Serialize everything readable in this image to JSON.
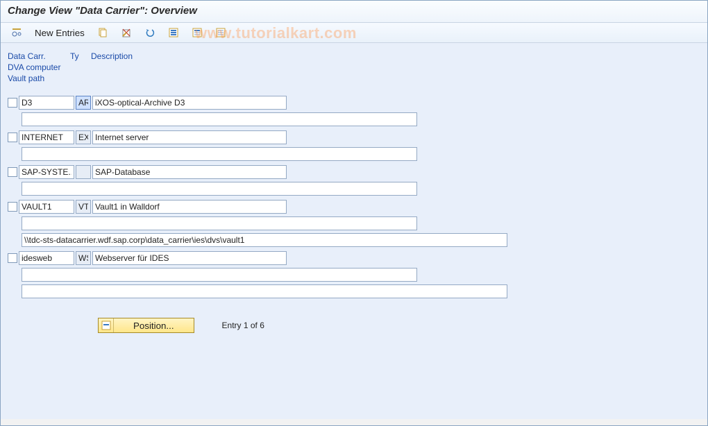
{
  "title": "Change View \"Data Carrier\": Overview",
  "watermark": "www.tutorialkart.com",
  "toolbar": {
    "new_entries": "New Entries"
  },
  "headers": {
    "data_carr": "Data Carr.",
    "ty": "Ty",
    "description": "Description",
    "dva_computer": "DVA computer",
    "vault_path": "Vault path"
  },
  "entries": [
    {
      "carrier": "D3",
      "type": "AR",
      "type_hl": true,
      "desc": "iXOS-optical-Archive D3",
      "dva": "",
      "path": ""
    },
    {
      "carrier": "INTERNET",
      "type": "EX",
      "type_hl": false,
      "desc": "Internet server",
      "dva": "",
      "path": ""
    },
    {
      "carrier": "SAP-SYSTE..",
      "type": "",
      "type_hl": false,
      "desc": "SAP-Database",
      "dva": "",
      "path": ""
    },
    {
      "carrier": "VAULT1",
      "type": "VT",
      "type_hl": false,
      "desc": "Vault1 in Walldorf",
      "dva": "",
      "path": "\\\\tdc-sts-datacarrier.wdf.sap.corp\\data_carrier\\ies\\dvs\\vault1"
    },
    {
      "carrier": "idesweb",
      "type": "WS",
      "type_hl": false,
      "desc": "Webserver für IDES",
      "dva": "",
      "path": ""
    }
  ],
  "footer": {
    "position_label": "Position...",
    "entry_text": "Entry 1 of 6"
  }
}
